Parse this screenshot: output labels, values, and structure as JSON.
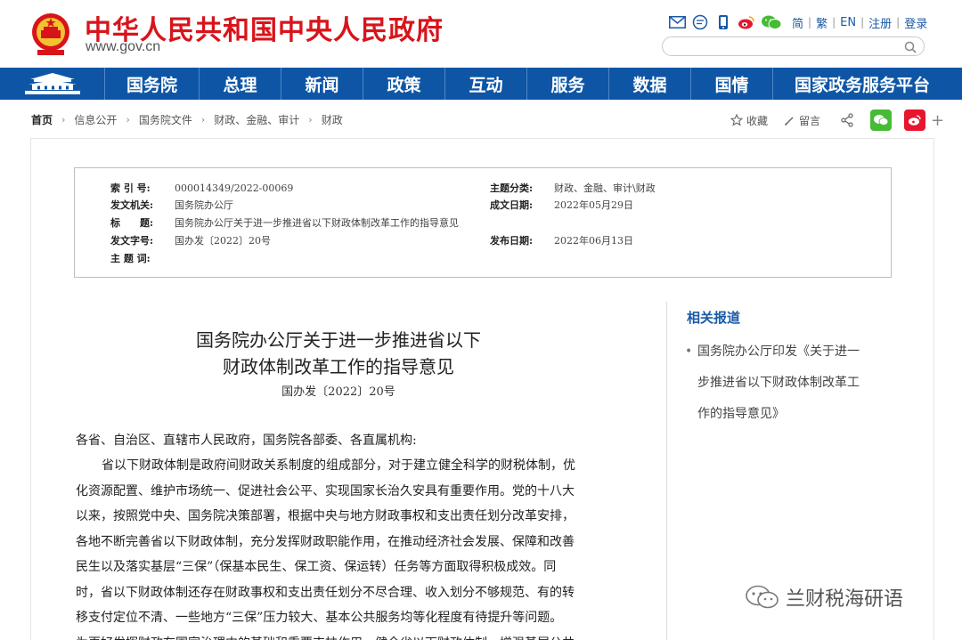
{
  "header": {
    "site_title": "中华人民共和国中央人民政府",
    "site_domain": "www.gov.cn",
    "lang_simplified": "简",
    "lang_traditional": "繁",
    "lang_en": "EN",
    "register": "注册",
    "login": "登录",
    "search_placeholder": "",
    "icons": [
      "mail-icon",
      "comment-icon",
      "mobile-icon",
      "weibo-icon",
      "wechat-icon",
      "search-icon"
    ]
  },
  "nav": {
    "items": [
      "国务院",
      "总理",
      "新闻",
      "政策",
      "互动",
      "服务",
      "数据",
      "国情",
      "国家政务服务平台"
    ]
  },
  "breadcrumb": [
    "首页",
    "信息公开",
    "国务院文件",
    "财政、金融、审计",
    "财政"
  ],
  "tools": {
    "favorite": "收藏",
    "comment": "留言"
  },
  "meta": {
    "index_no_label": "索 引 号:",
    "index_no": "000014349/2022-00069",
    "issuer_label": "发文机关:",
    "issuer": "国务院办公厅",
    "title_label": "标　　题:",
    "title": "国务院办公厅关于进一步推进省以下财政体制改革工作的指导意见",
    "doc_no_label": "发文字号:",
    "doc_no": "国办发〔2022〕20号",
    "keywords_label": "主 题 词:",
    "keywords": "",
    "category_label": "主题分类:",
    "category": "财政、金融、审计\\财政",
    "written_date_label": "成文日期:",
    "written_date": "2022年05月29日",
    "publish_date_label": "发布日期:",
    "publish_date": "2022年06月13日"
  },
  "article": {
    "title_line1": "国务院办公厅关于进一步推进省以下",
    "title_line2": "财政体制改革工作的指导意见",
    "doc_number": "国办发〔2022〕20号",
    "salutation": "各省、自治区、直辖市人民政府，国务院各部委、各直属机构:",
    "lines": [
      "省以下财政体制是政府间财政关系制度的组成部分，对于建立健全科学的财税体制，优",
      "化资源配置、维护市场统一、促进社会公平、实现国家长治久安具有重要作用。党的十八大",
      "以来，按照党中央、国务院决策部署，根据中央与地方财政事权和支出责任划分改革安排，",
      "各地不断完善省以下财政体制，充分发挥财政职能作用，在推动经济社会发展、保障和改善",
      "民生以及落实基层“三保”（保基本民生、保工资、保运转）任务等方面取得积极成效。同",
      "时，省以下财政体制还存在财政事权和支出责任划分不尽合理、收入划分不够规范、有的转",
      "移支付定位不清、一些地方“三保”压力较大、基本公共服务均等化程度有待提升等问题。",
      "为更好发挥财政在国家治理中的基础和重要支柱作用，健全省以下财政体制，增强基层公共"
    ]
  },
  "related": {
    "title": "相关报道",
    "lines": [
      "国务院办公厅印发《关于进一",
      "步推进省以下财政体制改革工",
      "作的指导意见》"
    ]
  },
  "watermark": "兰财税海研语",
  "colors": {
    "brand_red": "#d8141b",
    "nav_blue": "#0e56a5",
    "link_blue": "#1a5aa6",
    "wechat_green": "#46bb36",
    "weibo_red": "#e6162d"
  }
}
